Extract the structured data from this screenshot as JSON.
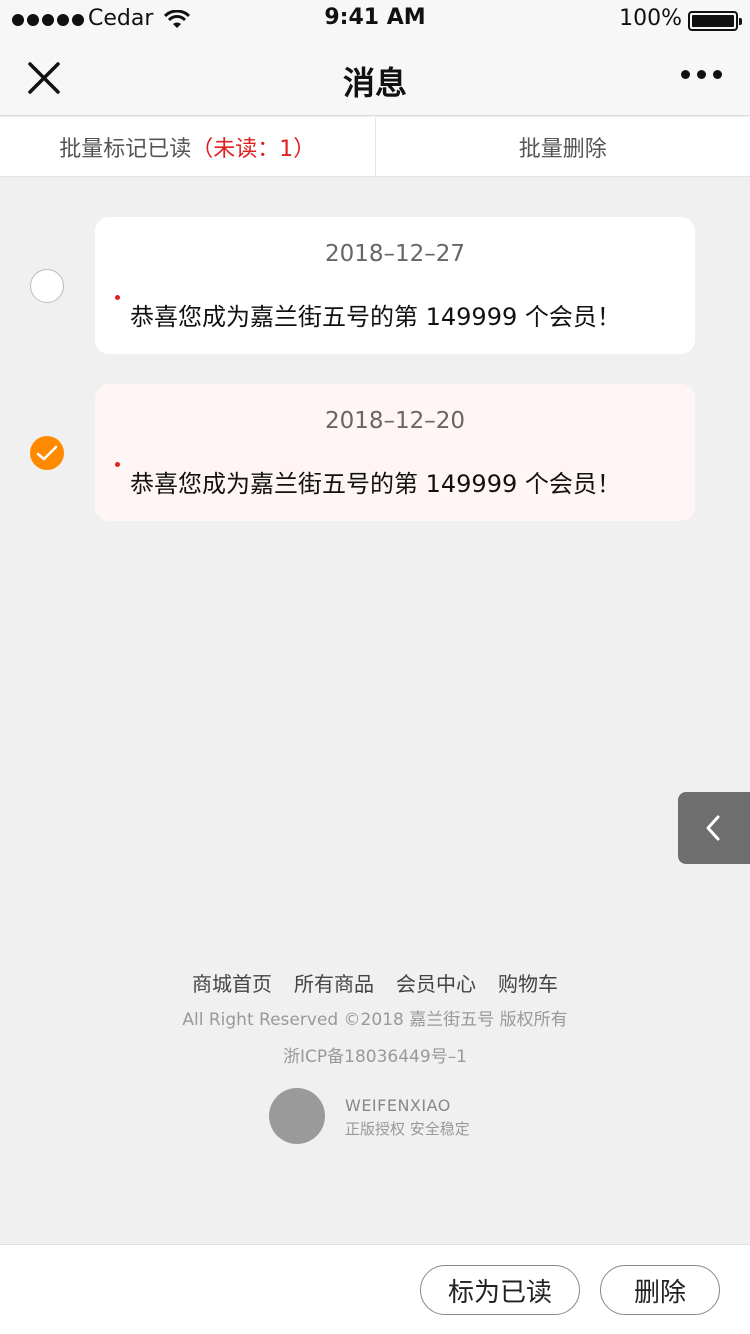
{
  "status_bar": {
    "carrier": "Cedar",
    "time": "9:41 AM",
    "battery": "100%"
  },
  "nav": {
    "title": "消息"
  },
  "tabs": {
    "mark_all_read": "批量标记已读",
    "unread_count": "（未读：1）",
    "batch_delete": "批量删除"
  },
  "messages": [
    {
      "date": "2018–12–27",
      "text": "恭喜您成为嘉兰街五号的第 149999 个会员！",
      "selected": false,
      "unread": true
    },
    {
      "date": "2018–12–20",
      "text": "恭喜您成为嘉兰街五号的第 149999 个会员！",
      "selected": true,
      "unread": true
    }
  ],
  "footer": {
    "links": [
      "商城首页",
      "所有商品",
      "会员中心",
      "购物车"
    ],
    "copyright": "All Right Reserved ©2018 嘉兰街五号 版权所有",
    "icp": "浙ICP备18036449号–1",
    "brand_name": "WEIFENXIAO",
    "brand_tagline": "正版授权   安全稳定"
  },
  "actions": {
    "mark_read": "标为已读",
    "delete": "删除"
  },
  "colors": {
    "accent": "#ff8a00",
    "unread_red": "#e02020",
    "selected_card": "#fff5f5"
  }
}
